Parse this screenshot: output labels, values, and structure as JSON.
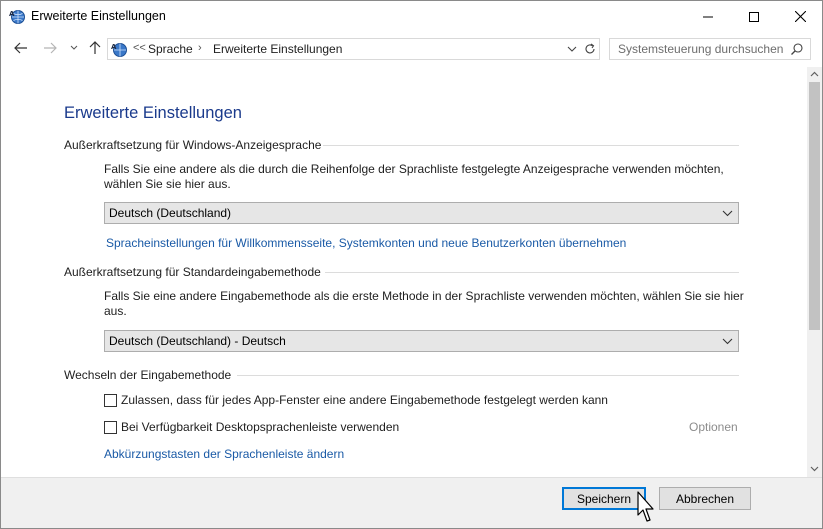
{
  "window": {
    "title": "Erweiterte Einstellungen"
  },
  "navigation": {
    "breadcrumb_overflow": "<<",
    "breadcrumb": [
      "Sprache",
      "Erweiterte Einstellungen"
    ],
    "search_placeholder": "Systemsteuerung durchsuchen"
  },
  "main": {
    "page_title": "Erweiterte Einstellungen",
    "display_language": {
      "header": "Außerkraftsetzung für Windows-Anzeigesprache",
      "description": "Falls Sie eine andere als die durch die Reihenfolge der Sprachliste festgelegte Anzeigesprache verwenden möchten, wählen Sie sie hier aus.",
      "selected": "Deutsch (Deutschland)",
      "link": "Spracheinstellungen für Willkommensseite, Systemkonten und neue Benutzerkonten übernehmen"
    },
    "input_method": {
      "header": "Außerkraftsetzung für Standardeingabemethode",
      "description": "Falls Sie eine andere Eingabemethode als die erste Methode in der Sprachliste verwenden möchten, wählen Sie sie hier aus.",
      "selected": "Deutsch (Deutschland) - Deutsch"
    },
    "switching": {
      "header": "Wechseln der Eingabemethode",
      "per_app_checkbox": "Zulassen, dass für jedes App-Fenster eine andere Eingabemethode festgelegt werden kann",
      "language_bar_checkbox": "Bei Verfügbarkeit Desktopsprachenleiste verwenden",
      "options_link": "Optionen",
      "hotkeys_link": "Abkürzungstasten der Sprachenleiste ändern"
    }
  },
  "footer": {
    "save_label": "Speichern",
    "cancel_label": "Abbrechen"
  },
  "colors": {
    "title_blue": "#1a3a8c",
    "link_blue": "#1a5aa6",
    "focus_blue": "#0078d7"
  }
}
